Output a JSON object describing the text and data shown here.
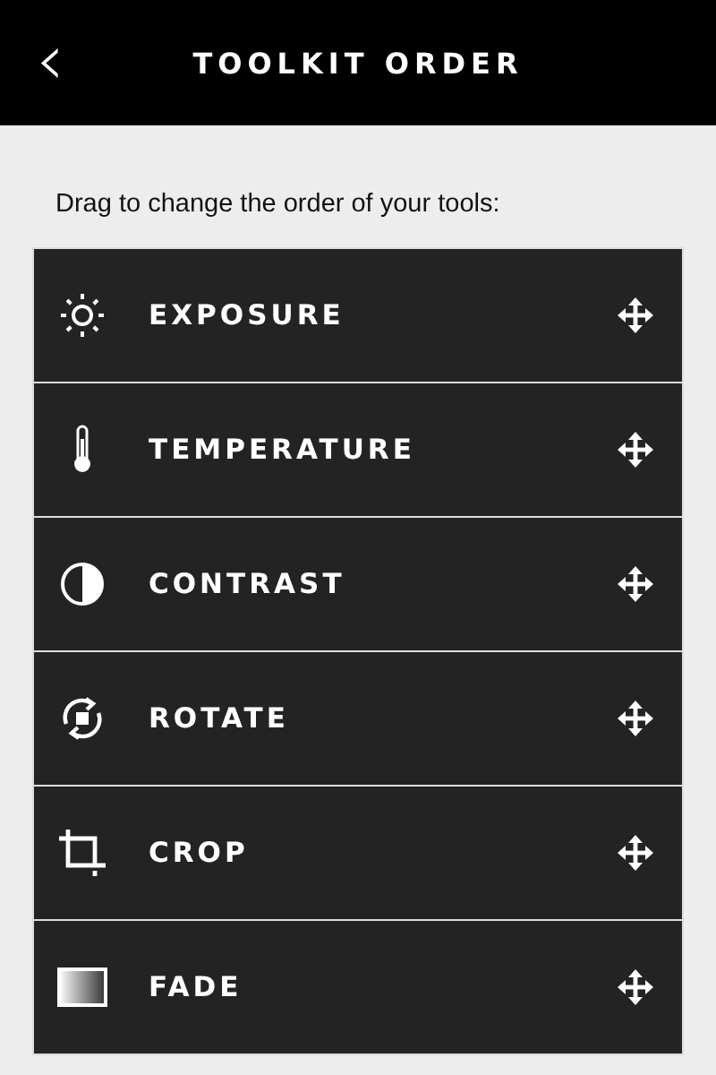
{
  "header": {
    "back": "‹",
    "title": "TOOLKIT ORDER"
  },
  "instruction": "Drag to change the order of your tools:",
  "tools": [
    {
      "kind": "exposure",
      "label": "EXPOSURE"
    },
    {
      "kind": "temperature",
      "label": "TEMPERATURE"
    },
    {
      "kind": "contrast",
      "label": "CONTRAST"
    },
    {
      "kind": "rotate",
      "label": "ROTATE"
    },
    {
      "kind": "crop",
      "label": "CROP"
    },
    {
      "kind": "fade",
      "label": "FADE"
    }
  ]
}
